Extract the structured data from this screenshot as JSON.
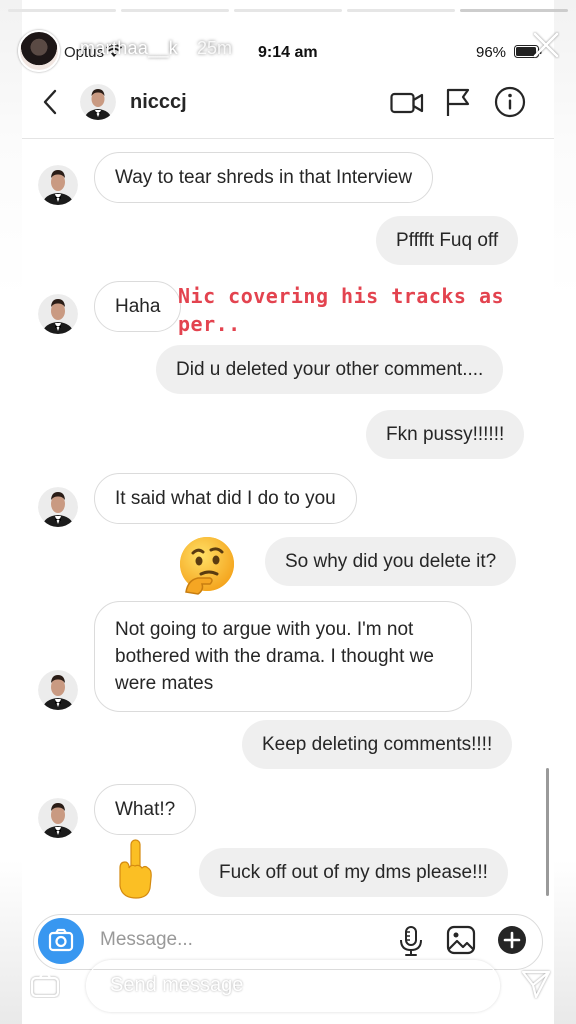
{
  "story": {
    "username": "marthaa__k",
    "time_ago": "25m",
    "progress_segments": 5,
    "reply_placeholder": "Send message"
  },
  "status_bar": {
    "carrier": "Optus",
    "time": "9:14 am",
    "battery": "96%"
  },
  "dm_header": {
    "username": "nicccj"
  },
  "overlay": {
    "text": "Nic covering his tracks as per..",
    "color": "#e3434f"
  },
  "messages": [
    {
      "from": "them",
      "text": "Way to tear shreds in that Interview"
    },
    {
      "from": "me",
      "text": "Pfffft Fuq off"
    },
    {
      "from": "them",
      "text": "Haha"
    },
    {
      "from": "me",
      "text": "Did u deleted your other comment...."
    },
    {
      "from": "me",
      "text": "Fkn pussy!!!!!!"
    },
    {
      "from": "them",
      "text": "It said what did I do to you"
    },
    {
      "from": "me",
      "text": "So why did you delete it?"
    },
    {
      "from": "them",
      "text": "Not going to argue with you. I'm not bothered with the drama. I thought we were mates"
    },
    {
      "from": "me",
      "text": "Keep deleting comments!!!!"
    },
    {
      "from": "them",
      "text": "What!?"
    },
    {
      "from": "me",
      "text": "Fuck off out of my dms please!!!"
    }
  ],
  "stickers": {
    "thinking": "thinking-face-emoji",
    "finger": "middle-finger-emoji"
  },
  "composer": {
    "placeholder": "Message..."
  },
  "colors": {
    "accent": "#3897f0",
    "outgoing_bubble": "#efefef",
    "incoming_border": "#dbdbdb"
  }
}
